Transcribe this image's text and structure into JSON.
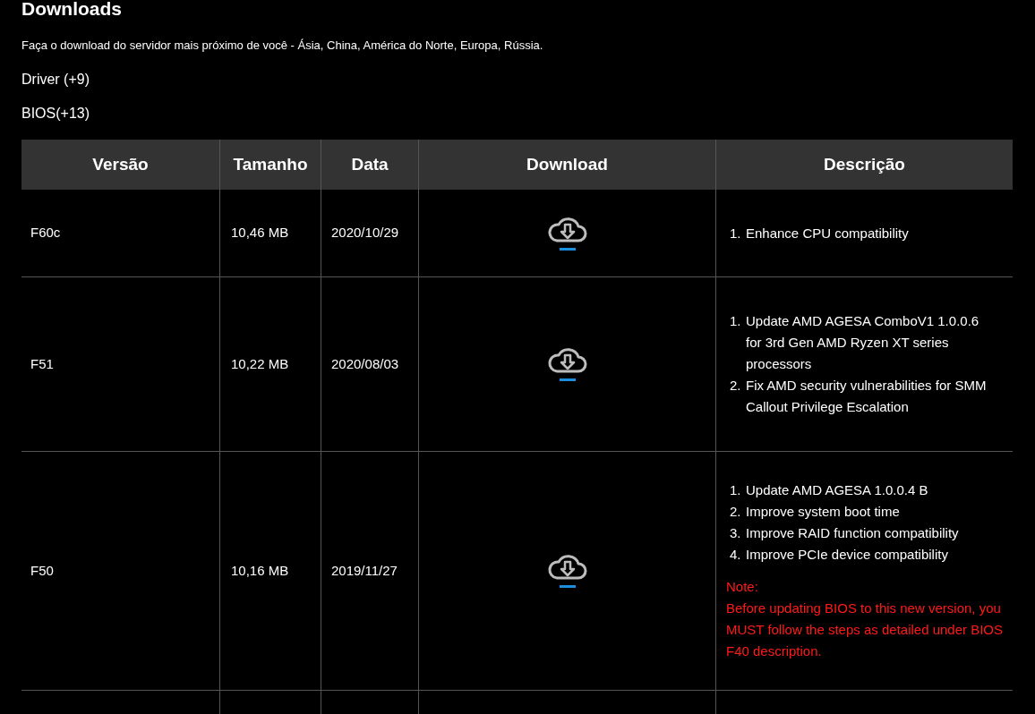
{
  "title": "Downloads",
  "subtitle": "Faça o download do servidor mais próximo de você - Ásia, China, América do Norte, Europa, Rússia.",
  "categories": [
    "Driver (+9)",
    "BIOS(+13)"
  ],
  "table": {
    "columns": [
      "Versão",
      "Tamanho",
      "Data",
      "Download",
      "Descrição"
    ],
    "rows": [
      {
        "version": "F60c",
        "size": "10,46 MB",
        "date": "2020/10/29",
        "items": [
          {
            "number": "1.",
            "text": "Enhance CPU compatibility"
          }
        ]
      },
      {
        "version": "F51",
        "size": "10,22 MB",
        "date": "2020/08/03",
        "items": [
          {
            "number": "1.",
            "text": "Update AMD AGESA ComboV1 1.0.0.6 for 3rd Gen AMD Ryzen XT series processors"
          },
          {
            "number": "2.",
            "text": "Fix AMD security vulnerabilities for SMM Callout Privilege Escalation"
          }
        ]
      },
      {
        "version": "F50",
        "size": "10,16 MB",
        "date": "2019/11/27",
        "items": [
          {
            "number": "1.",
            "text": "Update AMD AGESA 1.0.0.4 B"
          },
          {
            "number": "2.",
            "text": "Improve system boot time"
          },
          {
            "number": "3.",
            "text": "Improve RAID function compatibility"
          },
          {
            "number": "4.",
            "text": "Improve PCIe device compatibility"
          }
        ],
        "note": {
          "title": "Note:",
          "text": "Before updating BIOS to this new version, you MUST follow the steps as detailed under BIOS F40 description."
        }
      }
    ]
  }
}
